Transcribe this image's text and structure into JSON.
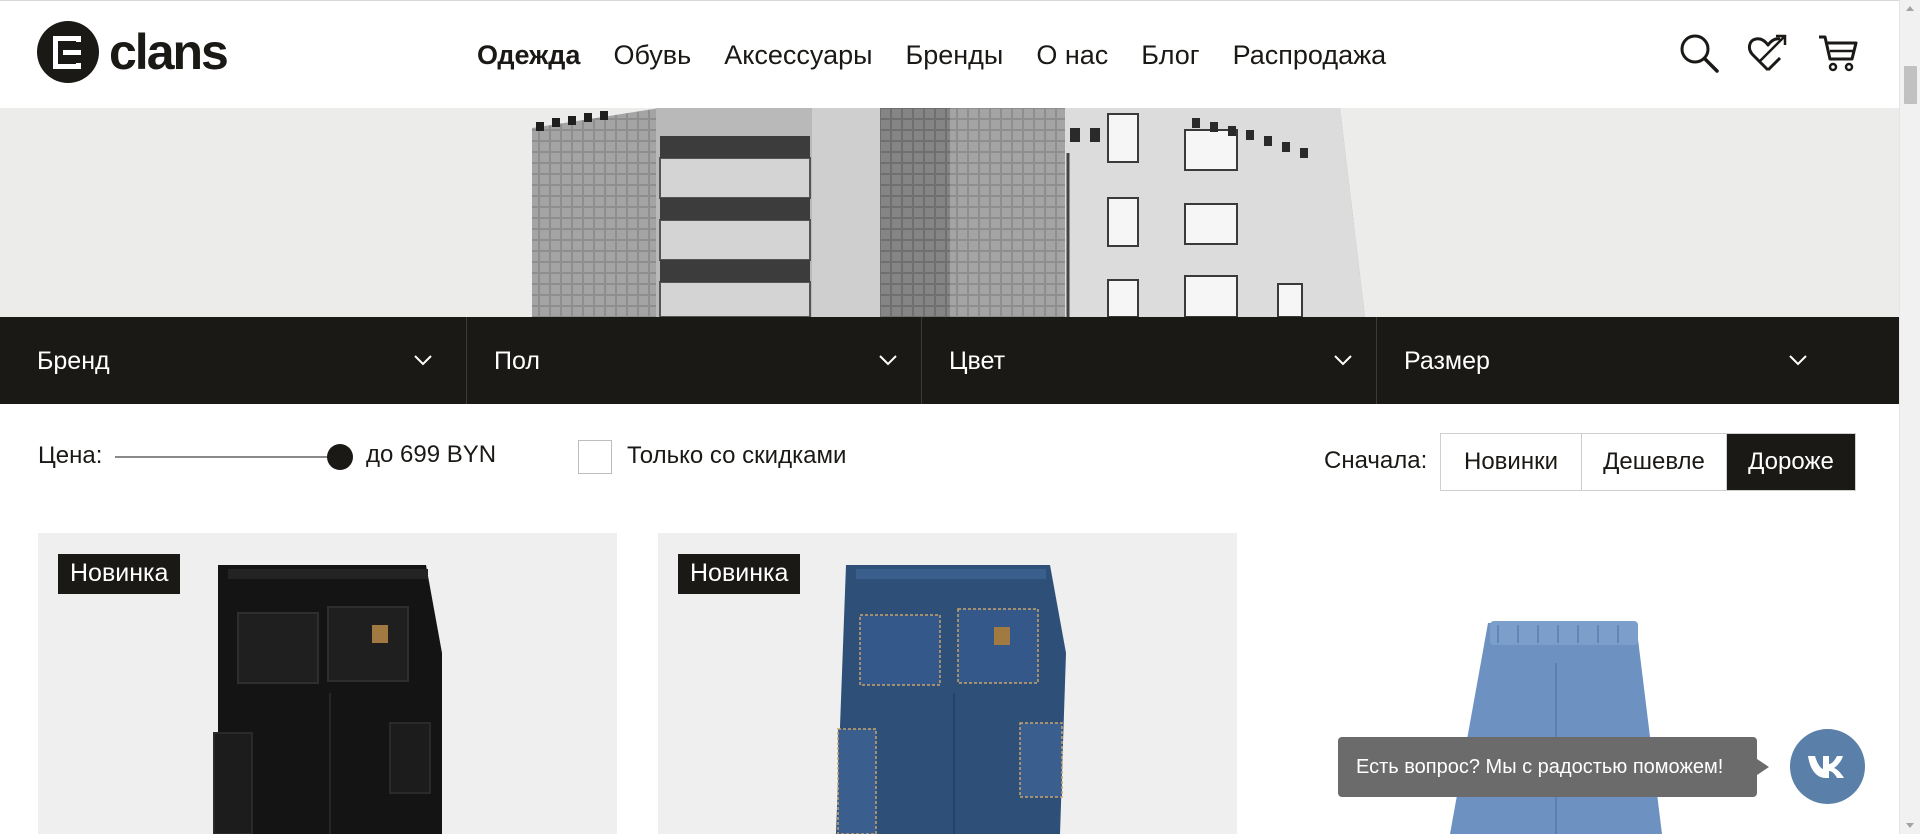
{
  "brand": {
    "name": "clans"
  },
  "nav": [
    {
      "label": "Одежда",
      "active": true
    },
    {
      "label": "Обувь",
      "active": false
    },
    {
      "label": "Аксессуары",
      "active": false
    },
    {
      "label": "Бренды",
      "active": false
    },
    {
      "label": "О нас",
      "active": false
    },
    {
      "label": "Блог",
      "active": false
    },
    {
      "label": "Распродажа",
      "active": false
    }
  ],
  "header_icons": [
    "search-icon",
    "wishlist-heart-icon",
    "cart-icon"
  ],
  "filters": [
    {
      "label": "Бренд"
    },
    {
      "label": "Пол"
    },
    {
      "label": "Цвет"
    },
    {
      "label": "Размер"
    }
  ],
  "price": {
    "label": "Цена:",
    "value_text": "до 699 BYN",
    "slider_fraction": 1.0
  },
  "discount_filter": {
    "label": "Только со скидками",
    "checked": false
  },
  "sort": {
    "label": "Сначала:",
    "options": [
      {
        "label": "Новинки",
        "active": false
      },
      {
        "label": "Дешевле",
        "active": false
      },
      {
        "label": "Дороже",
        "active": true
      }
    ]
  },
  "products": [
    {
      "badge": "Новинка",
      "item": "black carpenter pants"
    },
    {
      "badge": "Новинка",
      "item": "dark blue denim carpenter pants"
    },
    {
      "badge": "",
      "item": "light blue denim pants"
    }
  ],
  "chat": {
    "text": "Есть вопрос? Мы с радостью поможем!",
    "icon": "vk-icon"
  },
  "colors": {
    "dark": "#1b1916",
    "chat_bubble": "#6b6b6b",
    "vk": "#5a7fa8"
  }
}
